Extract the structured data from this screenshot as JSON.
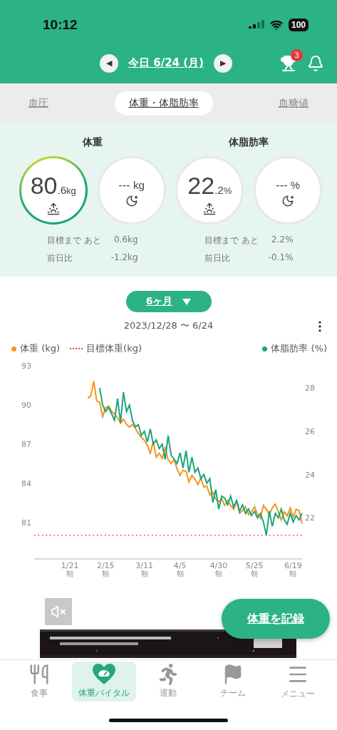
{
  "status_bar": {
    "time": "10:12",
    "battery": "100"
  },
  "header": {
    "prev": "◀",
    "date": "今日 6/24 (月)",
    "next": "▶",
    "trophy_badge": "3"
  },
  "tabs": [
    {
      "label": "血圧",
      "selected": false
    },
    {
      "label": "体重・体脂肪率",
      "selected": true
    },
    {
      "label": "血糖値",
      "selected": false
    }
  ],
  "summary": [
    {
      "title": "体重",
      "readings": [
        {
          "kind": "morning",
          "active": true,
          "whole": "80",
          "decimal": ".6",
          "unit": "kg"
        },
        {
          "kind": "night",
          "active": false,
          "whole": "---",
          "unit": "kg"
        }
      ],
      "goal_label": "目標まで あと",
      "goal_value": "0.6kg",
      "diff_label": "前日比",
      "diff_value": "-1.2kg"
    },
    {
      "title": "体脂肪率",
      "readings": [
        {
          "kind": "morning",
          "active": false,
          "whole": "22",
          "decimal": ".2",
          "unit": "%"
        },
        {
          "kind": "night",
          "active": false,
          "whole": "---",
          "unit": "%"
        }
      ],
      "goal_label": "目標まで あと",
      "goal_value": "2.2%",
      "diff_label": "前日比",
      "diff_value": "-0.1%"
    }
  ],
  "period": {
    "label": "6ヶ月",
    "range": "2023/12/28 〜 6/24"
  },
  "chart_data": {
    "type": "line",
    "ylim": [
      78.2,
      93
    ],
    "y2lim": [
      20.1,
      28
    ],
    "yticks": [
      81,
      84,
      87,
      90,
      93
    ],
    "y2ticks": [
      22,
      24,
      26,
      28
    ],
    "categories": [
      null,
      null,
      null,
      null,
      null,
      null,
      null,
      null,
      null,
      null,
      null,
      null,
      "1/21$_{朝}$",
      null,
      null,
      null,
      null,
      null,
      null,
      null,
      null,
      null,
      null,
      null,
      "2/15$_{朝}$",
      null,
      null,
      null,
      null,
      null,
      null,
      null,
      null,
      null,
      null,
      null,
      null,
      "3/11$_{朝}$",
      null,
      null,
      null,
      null,
      null,
      null,
      null,
      null,
      null,
      null,
      null,
      "4/5$_{朝}$",
      null,
      null,
      null,
      null,
      null,
      null,
      null,
      null,
      null,
      null,
      null,
      null,
      "4/30$_{朝}$",
      null,
      null,
      null,
      null,
      null,
      null,
      null,
      null,
      null,
      null,
      null,
      "5/25$_{朝}$",
      null,
      null,
      null,
      null,
      null,
      null,
      null,
      null,
      null,
      null,
      null,
      null,
      "6/19$_{朝}$",
      null,
      null,
      null
    ],
    "series": [
      {
        "name": "体重 (kg)",
        "color": "#f7931e",
        "values": [
          null,
          null,
          null,
          null,
          null,
          null,
          null,
          null,
          null,
          null,
          null,
          null,
          null,
          null,
          null,
          null,
          null,
          null,
          90.5,
          90.7,
          91.8,
          90.3,
          90.2,
          89.1,
          89.8,
          89.9,
          89.5,
          89.3,
          89.0,
          88.6,
          88.9,
          88.5,
          88.3,
          88.5,
          88.2,
          87.8,
          87.5,
          87.3,
          86.9,
          86.3,
          87.2,
          86.0,
          86.3,
          85.9,
          86.7,
          85.8,
          85.5,
          85.8,
          85.1,
          84.6,
          85.0,
          84.9,
          84.1,
          84.6,
          84.3,
          83.9,
          84.4,
          83.7,
          83.8,
          83.1,
          83.3,
          82.8,
          82.6,
          82.8,
          82.3,
          82.7,
          82.3,
          82.0,
          82.6,
          81.7,
          81.9,
          82.2,
          81.6,
          81.8,
          82.2,
          81.6,
          81.3,
          82.3,
          82.0,
          81.6,
          82.1,
          82.4,
          81.8,
          81.2,
          81.8,
          81.5,
          82.1,
          81.4,
          82.0,
          81.9,
          80.9
        ]
      },
      {
        "name": "目標体重(kg)",
        "color": "#ff3b30",
        "line_style": "dotted",
        "values": [
          80,
          80,
          80,
          80,
          80,
          80,
          80,
          80,
          80,
          80,
          80,
          80,
          80,
          80,
          80,
          80,
          80,
          80,
          80,
          80,
          80,
          80,
          80,
          80,
          80,
          80,
          80,
          80,
          80,
          80,
          80,
          80,
          80,
          80,
          80,
          80,
          80,
          80,
          80,
          80,
          80,
          80,
          80,
          80,
          80,
          80,
          80,
          80,
          80,
          80,
          80,
          80,
          80,
          80,
          80,
          80,
          80,
          80,
          80,
          80,
          80,
          80,
          80,
          80,
          80,
          80,
          80,
          80,
          80,
          80,
          80,
          80,
          80,
          80,
          80,
          80,
          80,
          80,
          80,
          80,
          80,
          80,
          80,
          80,
          80,
          80,
          80,
          80,
          80,
          80,
          80
        ]
      },
      {
        "name": "体脂肪率 (%)",
        "color": "#1aa57a",
        "axis": "y2",
        "values": [
          null,
          null,
          null,
          null,
          null,
          null,
          null,
          null,
          null,
          null,
          null,
          null,
          null,
          null,
          null,
          null,
          null,
          null,
          null,
          null,
          null,
          null,
          28.0,
          27.2,
          26.9,
          27.1,
          26.8,
          26.5,
          27.5,
          26.4,
          27.8,
          26.9,
          27.2,
          26.5,
          26.2,
          26.3,
          25.8,
          26.0,
          25.5,
          26.1,
          25.4,
          25.6,
          25.2,
          25.4,
          24.7,
          25.8,
          24.9,
          24.7,
          24.5,
          25.0,
          24.3,
          25.1,
          24.1,
          24.8,
          24.1,
          24.3,
          23.8,
          24.0,
          23.6,
          23.8,
          22.7,
          23.3,
          22.4,
          23.0,
          22.9,
          22.6,
          23.0,
          22.5,
          22.8,
          22.3,
          22.6,
          22.2,
          22.4,
          22.1,
          22.3,
          22.0,
          22.2,
          21.8,
          21.2,
          22.3,
          21.6,
          22.2,
          22.0,
          22.4,
          21.9,
          21.7,
          22.2,
          21.8,
          22.1,
          21.9,
          22.2
        ]
      }
    ]
  },
  "record_button": "体重を記録",
  "bottom_nav": [
    {
      "kind": "meal",
      "label": "食事",
      "selected": false
    },
    {
      "kind": "vital",
      "label": "体重バイタル",
      "selected": true
    },
    {
      "kind": "exercise",
      "label": "運動",
      "selected": false
    },
    {
      "kind": "team",
      "label": "チーム",
      "selected": false
    },
    {
      "kind": "menu",
      "label": "メニュー",
      "selected": false
    }
  ]
}
